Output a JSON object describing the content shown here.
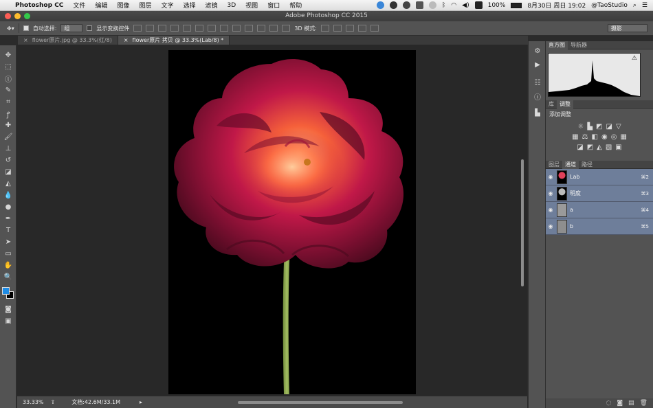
{
  "menubar": {
    "app_name": "Photoshop CC",
    "items": [
      "文件",
      "编辑",
      "图像",
      "图层",
      "文字",
      "选择",
      "滤镜",
      "3D",
      "视图",
      "窗口",
      "帮助"
    ],
    "battery": "100%",
    "datetime": "8月30日 周日  19:02",
    "user": "@TaoStudio"
  },
  "window": {
    "title": "Adobe Photoshop CC 2015"
  },
  "options": {
    "auto_select_label": "自动选择:",
    "auto_select_value": "组",
    "show_transform_label": "显示变换控件",
    "mode_3d_label": "3D 模式:",
    "workspace": "摄影"
  },
  "tabs": [
    {
      "label": "flower原片.jpg @ 33.3%(红/8)",
      "active": false
    },
    {
      "label": "flower原片 拷贝 @ 33.3%(Lab/8) *",
      "active": true
    }
  ],
  "status": {
    "zoom": "33.33%",
    "doc_size": "文档:42.6M/33.1M"
  },
  "panels": {
    "top_tabs": [
      "直方图",
      "导航器"
    ],
    "mid_tabs": [
      "库",
      "调整"
    ],
    "adjustments_title": "添加调整",
    "channel_tabs": [
      "图层",
      "通道",
      "路径"
    ],
    "channels": [
      {
        "name": "Lab",
        "shortcut": "⌘2"
      },
      {
        "name": "明度",
        "shortcut": "⌘3"
      },
      {
        "name": "a",
        "shortcut": "⌘4"
      },
      {
        "name": "b",
        "shortcut": "⌘5"
      }
    ]
  },
  "colors": {
    "foreground": "#1e8ce6",
    "background": "#000000",
    "channel_highlight": "#6e7e9a"
  }
}
